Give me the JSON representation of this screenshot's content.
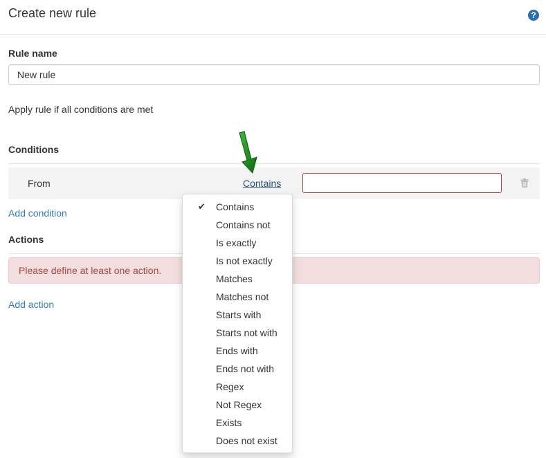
{
  "header": {
    "title": "Create new rule",
    "help_icon": "question-circle-icon",
    "help_glyph": "?"
  },
  "rule_name": {
    "label": "Rule name",
    "value": "New rule"
  },
  "apply_text": "Apply rule if all conditions are met",
  "conditions": {
    "title": "Conditions",
    "rows": [
      {
        "field": "From",
        "operator": "Contains",
        "value": ""
      }
    ],
    "add_label": "Add condition"
  },
  "actions": {
    "title": "Actions",
    "alert": "Please define at least one action.",
    "add_label": "Add action"
  },
  "operator_menu": {
    "selected": "Contains",
    "check_glyph": "✔",
    "items": [
      "Contains",
      "Contains not",
      "Is exactly",
      "Is not exactly",
      "Matches",
      "Matches not",
      "Starts with",
      "Starts not with",
      "Ends with",
      "Ends not with",
      "Regex",
      "Not Regex",
      "Exists",
      "Does not exist"
    ]
  },
  "colors": {
    "link": "#337ab7",
    "alert_bg": "#f2dede",
    "alert_text": "#a94442",
    "error_border": "#a94442",
    "annotation_arrow": "#1e8a1e"
  }
}
